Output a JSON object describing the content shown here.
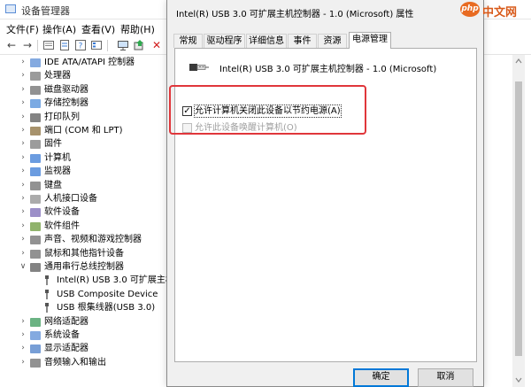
{
  "device_manager": {
    "title": "设备管理器",
    "menu": [
      "文件(F)",
      "操作(A)",
      "查看(V)",
      "帮助(H)"
    ],
    "tree": [
      {
        "label": "IDE ATA/ATAPI 控制器",
        "expanded": false,
        "icon": "ide-controller-icon",
        "child": false
      },
      {
        "label": "处理器",
        "expanded": false,
        "icon": "processor-icon",
        "child": false
      },
      {
        "label": "磁盘驱动器",
        "expanded": false,
        "icon": "disk-drive-icon",
        "child": false
      },
      {
        "label": "存储控制器",
        "expanded": false,
        "icon": "storage-controller-icon",
        "child": false
      },
      {
        "label": "打印队列",
        "expanded": false,
        "icon": "printer-icon",
        "child": false
      },
      {
        "label": "端口 (COM 和 LPT)",
        "expanded": false,
        "icon": "port-icon",
        "child": false
      },
      {
        "label": "固件",
        "expanded": false,
        "icon": "firmware-icon",
        "child": false
      },
      {
        "label": "计算机",
        "expanded": false,
        "icon": "computer-icon",
        "child": false
      },
      {
        "label": "监视器",
        "expanded": false,
        "icon": "monitor-icon",
        "child": false
      },
      {
        "label": "键盘",
        "expanded": false,
        "icon": "keyboard-icon",
        "child": false
      },
      {
        "label": "人机接口设备",
        "expanded": false,
        "icon": "hid-icon",
        "child": false
      },
      {
        "label": "软件设备",
        "expanded": false,
        "icon": "software-device-icon",
        "child": false
      },
      {
        "label": "软件组件",
        "expanded": false,
        "icon": "software-component-icon",
        "child": false
      },
      {
        "label": "声音、视频和游戏控制器",
        "expanded": false,
        "icon": "sound-icon",
        "child": false
      },
      {
        "label": "鼠标和其他指针设备",
        "expanded": false,
        "icon": "mouse-icon",
        "child": false
      },
      {
        "label": "通用串行总线控制器",
        "expanded": true,
        "icon": "usb-controller-icon",
        "child": false
      },
      {
        "label": "Intel(R) USB 3.0 可扩展主机控制器",
        "expanded": null,
        "icon": "usb-icon",
        "child": true
      },
      {
        "label": "USB Composite Device",
        "expanded": null,
        "icon": "usb-icon",
        "child": true
      },
      {
        "label": "USB 根集线器(USB 3.0)",
        "expanded": null,
        "icon": "usb-icon",
        "child": true
      },
      {
        "label": "网络适配器",
        "expanded": false,
        "icon": "network-adapter-icon",
        "child": false
      },
      {
        "label": "系统设备",
        "expanded": false,
        "icon": "system-device-icon",
        "child": false
      },
      {
        "label": "显示适配器",
        "expanded": false,
        "icon": "display-adapter-icon",
        "child": false
      },
      {
        "label": "音频输入和输出",
        "expanded": false,
        "icon": "audio-icon",
        "child": false
      }
    ]
  },
  "dialog": {
    "title": "Intel(R) USB 3.0 可扩展主机控制器 - 1.0 (Microsoft) 属性",
    "tabs": [
      "常规",
      "驱动程序",
      "详细信息",
      "事件",
      "资源",
      "电源管理"
    ],
    "active_tab": "电源管理",
    "device_name": "Intel(R) USB 3.0 可扩展主机控制器 - 1.0 (Microsoft)",
    "options": [
      {
        "label": "允许计算机关闭此设备以节约电源(A)",
        "checked": true,
        "enabled": true
      },
      {
        "label": "允许此设备唤醒计算机(O)",
        "checked": false,
        "enabled": false
      }
    ],
    "ok_label": "确定",
    "cancel_label": "取消"
  },
  "watermark": {
    "badge": "php",
    "text": "中文网"
  },
  "colors": {
    "highlight": "#e0363b",
    "accent": "#0078d7",
    "watermark": "#e86b22"
  }
}
